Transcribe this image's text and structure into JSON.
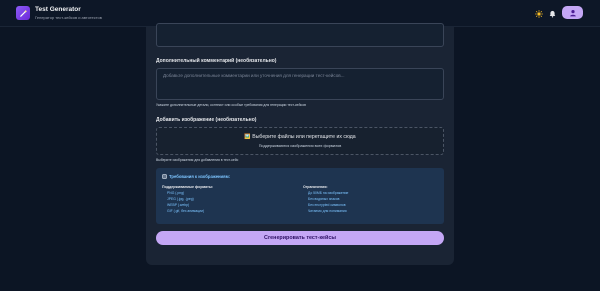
{
  "header": {
    "title": "Test Generator",
    "subtitle": "Генератор тест-кейсов и автотестов",
    "logo_icon": "wand-icon",
    "theme_icon": "sun-icon",
    "notification_icon": "bell-icon",
    "profile_icon": "user-icon"
  },
  "form": {
    "comment_label": "Дополнительный комментарий (необязательно)",
    "comment_placeholder": "Добавьте дополнительные комментарии или уточнения для генерации тест-кейсов...",
    "comment_hint": "Укажите дополнительные детали, контекст или особые требования для генерации тест-кейсов",
    "image_label": "Добавить изображение (необязательно)",
    "dropzone_text": "🖼️ Выберите файлы или перетащите их сюда",
    "dropzone_subtext": "Поддерживаются изображения всех форматов",
    "image_hint": "Выберите изображения для добавления в тест-кейс"
  },
  "requirements": {
    "title": "Требования к изображениям:",
    "formats_heading": "Поддерживаемые форматы:",
    "formats": [
      "PNG (.png)",
      "JPEG (.jpg, .jpeg)",
      "WEBP (.webp)",
      "GIF (.gif, без анимации)"
    ],
    "limits_heading": "Ограничения:",
    "limits": [
      "До 50МБ на изображение",
      "Без водяных знаков",
      "Без encrypted символов",
      "Читаемо для понимания"
    ]
  },
  "actions": {
    "generate_label": "Сгенерировать тест-кейсы"
  },
  "colors": {
    "accent": "#c4a7f5",
    "background": "#0c1524",
    "card": "#1a2434",
    "info_box": "#1e3450",
    "info_text": "#7cc4ff"
  }
}
